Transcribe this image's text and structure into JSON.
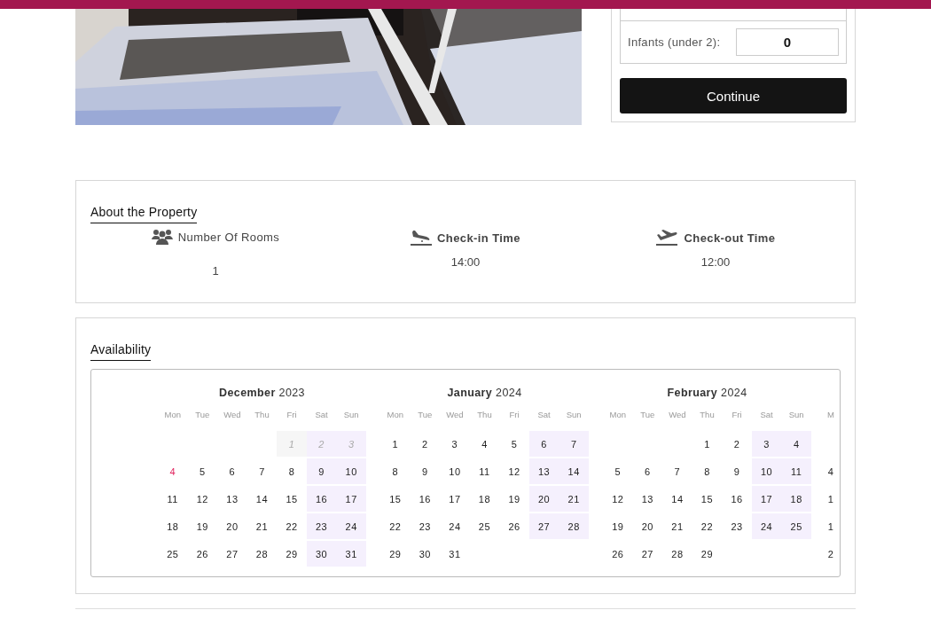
{
  "booking": {
    "fields": [
      {
        "label": "Infants (under 2):",
        "value": "0"
      }
    ],
    "button": "Continue"
  },
  "about": {
    "title": "About the Property",
    "items": [
      {
        "kind": "rooms",
        "label": "Number Of Rooms",
        "value": "1"
      },
      {
        "kind": "checkin",
        "label": "Check-in Time",
        "value": "14:00"
      },
      {
        "kind": "checkout",
        "label": "Check-out Time",
        "value": "12:00"
      }
    ]
  },
  "availability": {
    "title": "Availability",
    "months": [
      {
        "name": "December",
        "year": "2023",
        "weekdays": [
          "Mon",
          "Tue",
          "Wed",
          "Thu",
          "Fri",
          "Sat",
          "Sun"
        ],
        "weeks": [
          [
            {
              "kind": "blank"
            },
            {
              "kind": "blank"
            },
            {
              "kind": "blank"
            },
            {
              "kind": "blank"
            },
            {
              "day": "1",
              "past": true,
              "today": false
            },
            {
              "day": "2",
              "past": true,
              "today": false
            },
            {
              "day": "3",
              "past": true,
              "today": false
            }
          ],
          [
            {
              "day": "4",
              "past": false,
              "today": true
            },
            {
              "day": "5",
              "past": false,
              "today": false
            },
            {
              "day": "6",
              "past": false,
              "today": false
            },
            {
              "day": "7",
              "past": false,
              "today": false
            },
            {
              "day": "8",
              "past": false,
              "today": false
            },
            {
              "day": "9",
              "past": false,
              "today": false
            },
            {
              "day": "10",
              "past": false,
              "today": false
            }
          ],
          [
            {
              "day": "11",
              "past": false,
              "today": false
            },
            {
              "day": "12",
              "past": false,
              "today": false
            },
            {
              "day": "13",
              "past": false,
              "today": false
            },
            {
              "day": "14",
              "past": false,
              "today": false
            },
            {
              "day": "15",
              "past": false,
              "today": false
            },
            {
              "day": "16",
              "past": false,
              "today": false
            },
            {
              "day": "17",
              "past": false,
              "today": false
            }
          ],
          [
            {
              "day": "18",
              "past": false,
              "today": false
            },
            {
              "day": "19",
              "past": false,
              "today": false
            },
            {
              "day": "20",
              "past": false,
              "today": false
            },
            {
              "day": "21",
              "past": false,
              "today": false
            },
            {
              "day": "22",
              "past": false,
              "today": false
            },
            {
              "day": "23",
              "past": false,
              "today": false
            },
            {
              "day": "24",
              "past": false,
              "today": false
            }
          ],
          [
            {
              "day": "25",
              "past": false,
              "today": false
            },
            {
              "day": "26",
              "past": false,
              "today": false
            },
            {
              "day": "27",
              "past": false,
              "today": false
            },
            {
              "day": "28",
              "past": false,
              "today": false
            },
            {
              "day": "29",
              "past": false,
              "today": false
            },
            {
              "day": "30",
              "past": false,
              "today": false
            },
            {
              "day": "31",
              "past": false,
              "today": false
            }
          ]
        ]
      },
      {
        "name": "January",
        "year": "2024",
        "weekdays": [
          "Mon",
          "Tue",
          "Wed",
          "Thu",
          "Fri",
          "Sat",
          "Sun"
        ],
        "weeks": [
          [
            {
              "day": "1",
              "past": false,
              "today": false
            },
            {
              "day": "2",
              "past": false,
              "today": false
            },
            {
              "day": "3",
              "past": false,
              "today": false
            },
            {
              "day": "4",
              "past": false,
              "today": false
            },
            {
              "day": "5",
              "past": false,
              "today": false
            },
            {
              "day": "6",
              "past": false,
              "today": false
            },
            {
              "day": "7",
              "past": false,
              "today": false
            }
          ],
          [
            {
              "day": "8",
              "past": false,
              "today": false
            },
            {
              "day": "9",
              "past": false,
              "today": false
            },
            {
              "day": "10",
              "past": false,
              "today": false
            },
            {
              "day": "11",
              "past": false,
              "today": false
            },
            {
              "day": "12",
              "past": false,
              "today": false
            },
            {
              "day": "13",
              "past": false,
              "today": false
            },
            {
              "day": "14",
              "past": false,
              "today": false
            }
          ],
          [
            {
              "day": "15",
              "past": false,
              "today": false
            },
            {
              "day": "16",
              "past": false,
              "today": false
            },
            {
              "day": "17",
              "past": false,
              "today": false
            },
            {
              "day": "18",
              "past": false,
              "today": false
            },
            {
              "day": "19",
              "past": false,
              "today": false
            },
            {
              "day": "20",
              "past": false,
              "today": false
            },
            {
              "day": "21",
              "past": false,
              "today": false
            }
          ],
          [
            {
              "day": "22",
              "past": false,
              "today": false
            },
            {
              "day": "23",
              "past": false,
              "today": false
            },
            {
              "day": "24",
              "past": false,
              "today": false
            },
            {
              "day": "25",
              "past": false,
              "today": false
            },
            {
              "day": "26",
              "past": false,
              "today": false
            },
            {
              "day": "27",
              "past": false,
              "today": false
            },
            {
              "day": "28",
              "past": false,
              "today": false
            }
          ],
          [
            {
              "day": "29",
              "past": false,
              "today": false
            },
            {
              "day": "30",
              "past": false,
              "today": false
            },
            {
              "day": "31",
              "past": false,
              "today": false
            },
            {
              "kind": "blank"
            },
            {
              "kind": "blank"
            },
            {
              "kind": "blank"
            },
            {
              "kind": "blank"
            }
          ]
        ]
      },
      {
        "name": "February",
        "year": "2024",
        "weekdays": [
          "Mon",
          "Tue",
          "Wed",
          "Thu",
          "Fri",
          "Sat",
          "Sun"
        ],
        "weeks": [
          [
            {
              "kind": "blank"
            },
            {
              "kind": "blank"
            },
            {
              "kind": "blank"
            },
            {
              "day": "1",
              "past": false,
              "today": false
            },
            {
              "day": "2",
              "past": false,
              "today": false
            },
            {
              "day": "3",
              "past": false,
              "today": false
            },
            {
              "day": "4",
              "past": false,
              "today": false
            }
          ],
          [
            {
              "day": "5",
              "past": false,
              "today": false
            },
            {
              "day": "6",
              "past": false,
              "today": false
            },
            {
              "day": "7",
              "past": false,
              "today": false
            },
            {
              "day": "8",
              "past": false,
              "today": false
            },
            {
              "day": "9",
              "past": false,
              "today": false
            },
            {
              "day": "10",
              "past": false,
              "today": false
            },
            {
              "day": "11",
              "past": false,
              "today": false
            }
          ],
          [
            {
              "day": "12",
              "past": false,
              "today": false
            },
            {
              "day": "13",
              "past": false,
              "today": false
            },
            {
              "day": "14",
              "past": false,
              "today": false
            },
            {
              "day": "15",
              "past": false,
              "today": false
            },
            {
              "day": "16",
              "past": false,
              "today": false
            },
            {
              "day": "17",
              "past": false,
              "today": false
            },
            {
              "day": "18",
              "past": false,
              "today": false
            }
          ],
          [
            {
              "day": "19",
              "past": false,
              "today": false
            },
            {
              "day": "20",
              "past": false,
              "today": false
            },
            {
              "day": "21",
              "past": false,
              "today": false
            },
            {
              "day": "22",
              "past": false,
              "today": false
            },
            {
              "day": "23",
              "past": false,
              "today": false
            },
            {
              "day": "24",
              "past": false,
              "today": false
            },
            {
              "day": "25",
              "past": false,
              "today": false
            }
          ],
          [
            {
              "day": "26",
              "past": false,
              "today": false
            },
            {
              "day": "27",
              "past": false,
              "today": false
            },
            {
              "day": "28",
              "past": false,
              "today": false
            },
            {
              "day": "29",
              "past": false,
              "today": false
            },
            {
              "kind": "blank"
            },
            {
              "kind": "blank"
            },
            {
              "kind": "blank"
            }
          ]
        ]
      },
      {
        "weekdays": [
          "M"
        ],
        "weeks": [
          [
            {
              "kind": "blank"
            }
          ],
          [
            {
              "day": "4",
              "past": false,
              "today": false
            }
          ],
          [
            {
              "day": "1",
              "past": false,
              "today": false
            }
          ],
          [
            {
              "day": "1",
              "past": false,
              "today": false
            }
          ],
          [
            {
              "day": "2",
              "past": false,
              "today": false
            }
          ]
        ]
      }
    ]
  }
}
